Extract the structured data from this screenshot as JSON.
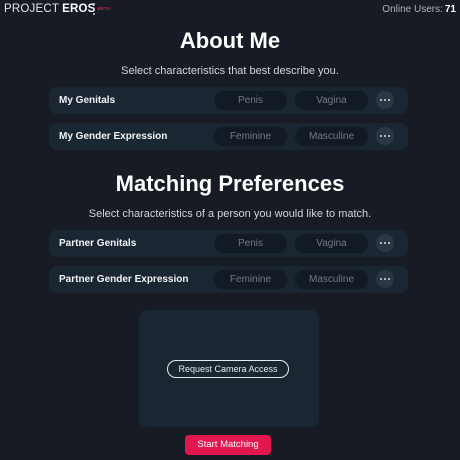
{
  "header": {
    "logo_part1": "PROJECT",
    "logo_part2": "EROS",
    "logo_badge": "BETA",
    "online_label": "Online Users:",
    "online_count": "71"
  },
  "about": {
    "title": "About Me",
    "subtitle": "Select characteristics that best describe you.",
    "rows": [
      {
        "label": "My Genitals",
        "options": [
          "Penis",
          "Vagina"
        ]
      },
      {
        "label": "My Gender Expression",
        "options": [
          "Feminine",
          "Masculine"
        ]
      }
    ]
  },
  "preferences": {
    "title": "Matching Preferences",
    "subtitle": "Select characteristics of a person you would like to match.",
    "rows": [
      {
        "label": "Partner Genitals",
        "options": [
          "Penis",
          "Vagina"
        ]
      },
      {
        "label": "Partner Gender Expression",
        "options": [
          "Feminine",
          "Masculine"
        ]
      }
    ]
  },
  "camera": {
    "button_label": "Request Camera Access"
  },
  "start_button_label": "Start Matching",
  "colors": {
    "background": "#161b24",
    "row_background": "#1b2633",
    "pill_background": "#121b25",
    "accent": "#e3174f"
  },
  "icons": {
    "menu": "vertical-ellipsis-icon",
    "more": "more-horizontal-icon"
  }
}
